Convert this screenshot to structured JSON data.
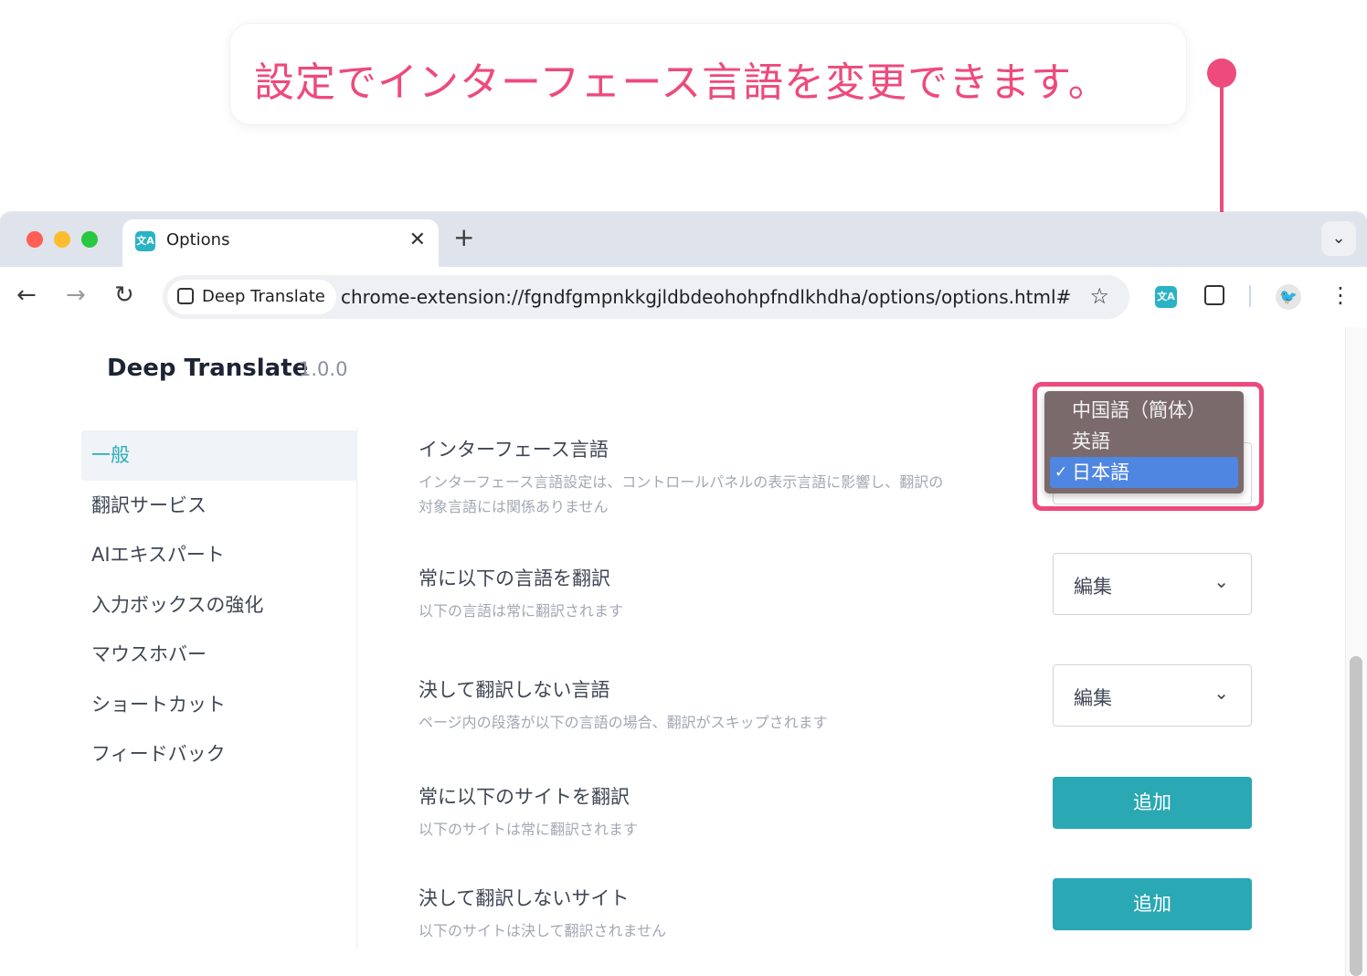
{
  "callout": {
    "text": "設定でインターフェース言語を変更できます。"
  },
  "colors": {
    "accent": "#ee4a7c",
    "brand": "#2aa8b3",
    "selection": "#4f86e2"
  },
  "browser": {
    "tab": {
      "title": "Options",
      "icon": "translate-icon",
      "close": "✕"
    },
    "new_tab": "+",
    "tab_menu": "⌄",
    "toolbar": {
      "back": "←",
      "forward": "→",
      "reload": "↻",
      "ext_chip_label": "Deep Translate",
      "url": "chrome-extension://fgndfgmpnkkgjldbdeohohpfndlkhdha/options/options.html#...",
      "star": "☆",
      "menu": "⋮"
    }
  },
  "app": {
    "name": "Deep Translate",
    "version": "1.0.0"
  },
  "sidebar": {
    "items": [
      {
        "label": "一般",
        "active": true
      },
      {
        "label": "翻訳サービス"
      },
      {
        "label": "AIエキスパート"
      },
      {
        "label": "入力ボックスの強化"
      },
      {
        "label": "マウスホバー"
      },
      {
        "label": "ショートカット"
      },
      {
        "label": "フィードバック"
      }
    ]
  },
  "settings": [
    {
      "title": "インターフェース言語",
      "desc_line1": "インターフェース言語設定は、コントロールパネルの表示言語に影響し、翻訳の",
      "desc_line2": "対象言語には関係ありません"
    },
    {
      "title": "常に以下の言語を翻訳",
      "desc": "以下の言語は常に翻訳されます",
      "control": "編集"
    },
    {
      "title": "決して翻訳しない言語",
      "desc": "ページ内の段落が以下の言語の場合、翻訳がスキップされます",
      "control": "編集"
    },
    {
      "title": "常に以下のサイトを翻訳",
      "desc": "以下のサイトは常に翻訳されます",
      "control": "追加"
    },
    {
      "title": "決して翻訳しないサイト",
      "desc": "以下のサイトは決して翻訳されません",
      "control": "追加"
    }
  ],
  "language_dropdown": {
    "options": [
      "中国語（簡体）",
      "英語",
      "日本語"
    ],
    "selected": "日本語",
    "check": "✓"
  },
  "chevron": "⌄"
}
